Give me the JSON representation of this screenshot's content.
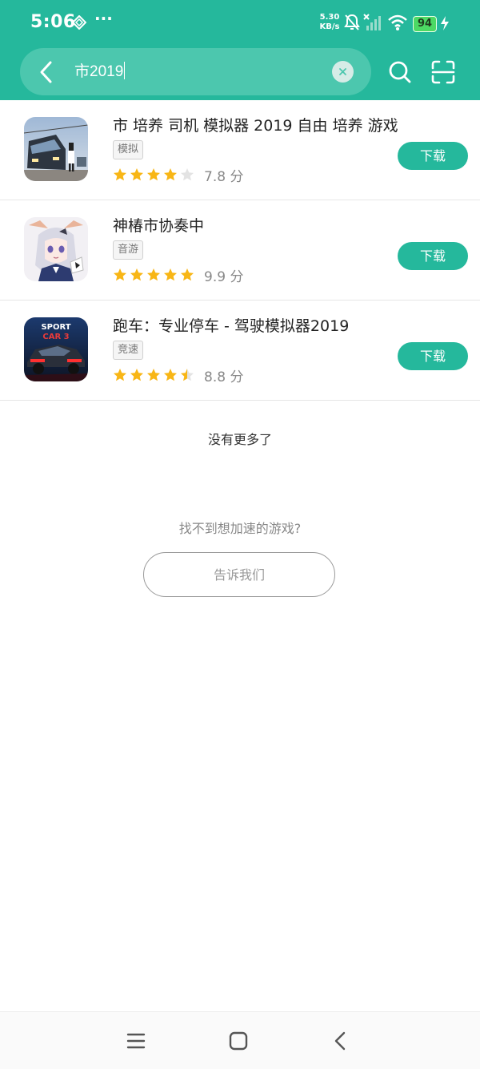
{
  "status_bar": {
    "time": "5:06",
    "more": "···",
    "net_speed_value": "5.30",
    "net_speed_unit": "KB/s",
    "battery": "94"
  },
  "search": {
    "query": "市2019"
  },
  "results": [
    {
      "name": "市 培养 司机 模拟器 2019 自由 培养 游戏",
      "tag": "模拟",
      "stars": 4,
      "rating_text": "7.8 分",
      "download_label": "下载",
      "icon": "train-game-icon"
    },
    {
      "name": "神椿市协奏中",
      "tag": "音游",
      "stars": 5,
      "rating_text": "9.9 分",
      "download_label": "下载",
      "icon": "anime-girl-game-icon"
    },
    {
      "name": "跑车：专业停车 - 驾驶模拟器2019",
      "tag": "竞速",
      "stars": 4.5,
      "rating_text": "8.8 分",
      "download_label": "下载",
      "icon": "sport-car-game-icon"
    }
  ],
  "footer": {
    "no_more": "没有更多了",
    "cant_find": "找不到想加速的游戏?",
    "tell_us": "告诉我们"
  },
  "colors": {
    "accent": "#25b89c",
    "star": "#f8b616",
    "star_empty": "#e3e3e3"
  }
}
